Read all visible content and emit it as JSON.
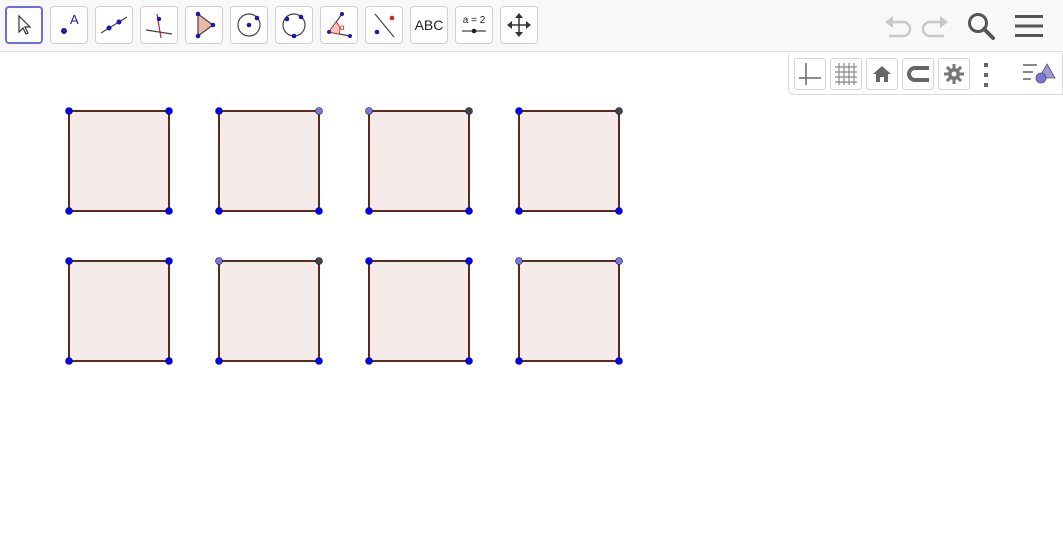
{
  "toolbar": {
    "tools": [
      {
        "id": "move",
        "icon": "cursor-icon",
        "active": true
      },
      {
        "id": "point",
        "icon": "point-icon",
        "label": "A"
      },
      {
        "id": "line",
        "icon": "line-icon"
      },
      {
        "id": "perpendicular",
        "icon": "perpendicular-line-icon"
      },
      {
        "id": "polygon",
        "icon": "polygon-icon"
      },
      {
        "id": "circle",
        "icon": "circle-center-point-icon"
      },
      {
        "id": "circle3",
        "icon": "circle-three-points-icon"
      },
      {
        "id": "angle",
        "icon": "angle-icon",
        "label": "α"
      },
      {
        "id": "reflect",
        "icon": "reflect-line-icon"
      },
      {
        "id": "text",
        "icon": "text-icon",
        "label": "ABC"
      },
      {
        "id": "slider",
        "icon": "slider-icon",
        "label": "a = 2"
      },
      {
        "id": "move-view",
        "icon": "move-graphics-view-icon"
      }
    ],
    "right": [
      "undo-icon",
      "redo-icon",
      "search-icon",
      "menu-icon"
    ]
  },
  "stylebar": {
    "buttons": [
      "axes-icon",
      "grid-icon",
      "home-icon",
      "point-capturing-icon",
      "gear-icon",
      "more-vertical-icon",
      "style-bar-toggle-icon"
    ]
  },
  "colors": {
    "square_fill": "#f5ebe8",
    "square_stroke": "#5a2a1e",
    "point_blue": "#0000ff",
    "point_light": "#7777dd",
    "point_dark": "#444444",
    "accent": "#6d6ce8"
  },
  "squares": [
    {
      "row": 0,
      "col": 0,
      "vertices": [
        "blue",
        "blue",
        "blue",
        "blue"
      ]
    },
    {
      "row": 0,
      "col": 1,
      "vertices": [
        "blue",
        "light",
        "blue",
        "blue"
      ]
    },
    {
      "row": 0,
      "col": 2,
      "vertices": [
        "light",
        "dark",
        "blue",
        "blue"
      ]
    },
    {
      "row": 0,
      "col": 3,
      "vertices": [
        "blue",
        "dark",
        "blue",
        "blue"
      ]
    },
    {
      "row": 1,
      "col": 0,
      "vertices": [
        "blue",
        "blue",
        "blue",
        "blue"
      ]
    },
    {
      "row": 1,
      "col": 1,
      "vertices": [
        "light",
        "dark",
        "blue",
        "blue"
      ]
    },
    {
      "row": 1,
      "col": 2,
      "vertices": [
        "blue",
        "blue",
        "blue",
        "blue"
      ]
    },
    {
      "row": 1,
      "col": 3,
      "vertices": [
        "light",
        "light",
        "blue",
        "blue"
      ]
    }
  ]
}
